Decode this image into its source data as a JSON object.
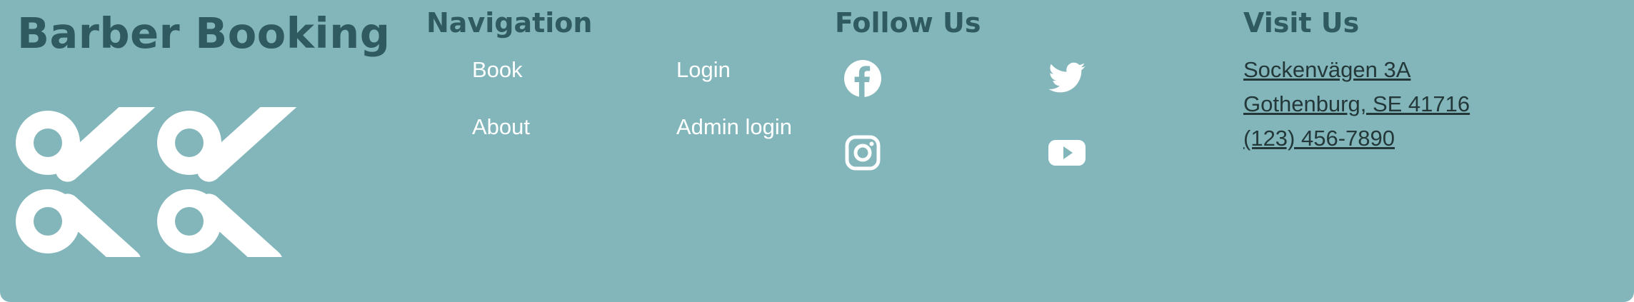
{
  "brand": {
    "title": "Barber Booking",
    "logo_icon": "scissors-logo-icon"
  },
  "navigation": {
    "title": "Navigation",
    "links": [
      {
        "label": "Book"
      },
      {
        "label": "Login"
      },
      {
        "label": "About"
      },
      {
        "label": "Admin login"
      }
    ]
  },
  "follow": {
    "title": "Follow Us",
    "icons": [
      "facebook-icon",
      "twitter-icon",
      "instagram-icon",
      "youtube-icon"
    ]
  },
  "visit": {
    "title": "Visit Us",
    "street": "Sockenvägen 3A",
    "city": "Gothenburg, SE 41716",
    "phone": "(123) 456-7890"
  },
  "colors": {
    "footer_bg": "#82b6ba",
    "heading": "#2f5a5f",
    "link": "#ffffff",
    "address_text": "#24383a"
  }
}
